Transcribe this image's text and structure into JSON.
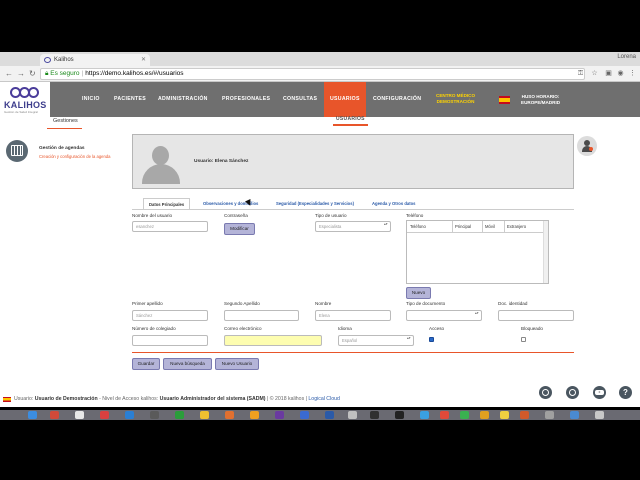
{
  "browser": {
    "tab_title": "Kalihos",
    "profile": "Lorena",
    "secure_label": "Es seguro",
    "url": "https://demo.kalihos.es/#/usuarios"
  },
  "logo": {
    "brand": "KALIHOS",
    "tagline": "Gestión de Salud Integral"
  },
  "menu": {
    "inicio": "INICIO",
    "pacientes": "PACIENTES",
    "administracion": "ADMINISTRACIÓN",
    "profesionales": "PROFESIONALES",
    "consultas": "CONSULTAS",
    "usuarios": "USUARIOS",
    "configuracion": "CONFIGURACIÓN"
  },
  "center": {
    "line1": "CENTRO MÉDICO",
    "line2": "DEMOSTRACIÓN"
  },
  "timezone": {
    "line1": "HUSO HORARIO:",
    "line2": "EUROPE/MADRID"
  },
  "subnav": {
    "gestiones": "Gestiones",
    "usuarios": "USUARIOS"
  },
  "agenda": {
    "title": "Gestión de agendas",
    "subtitle": "Creación y configuración de la agenda"
  },
  "profile": {
    "name": "Usuario: Elena Sánchez"
  },
  "tabs": {
    "datos": "Datos Principales",
    "observaciones": "Observaciones y domicilios",
    "seguridad": "Seguridad (Especialidades y Servicios)",
    "agenda": "Agenda y Otros datos"
  },
  "form": {
    "nombre_usuario_label": "Nombre del usuario",
    "nombre_usuario_value": "esanchez",
    "contrasena_label": "Contraseña",
    "modificar": "Modificar",
    "tipo_usuario_label": "Tipo de usuario",
    "tipo_usuario_value": "Especialista",
    "telefono_label": "Teléfono",
    "phone_cols": [
      "Teléfono",
      "Principal",
      "Móvil",
      "Extranjero"
    ],
    "nuevo": "Nuevo",
    "primer_apellido_label": "Primer apellido",
    "primer_apellido_value": "Sánchez",
    "segundo_apellido_label": "Segundo Apellido",
    "nombre_label": "Nombre",
    "nombre_value": "Elena",
    "tipo_documento_label": "Tipo de documento",
    "doc_identidad_label": "Doc. identidad",
    "colegiado_label": "Número de colegiado",
    "email_label": "Correo electrónico",
    "idioma_label": "Idioma",
    "idioma_value": "Español",
    "acceso_label": "Acceso",
    "bloqueado_label": "Bloqueado"
  },
  "actions": {
    "guardar": "Guardar",
    "nueva_busqueda": "Nueva búsqueda",
    "nuevo_usuario": "Nuevo Usuario"
  },
  "footer": {
    "prefix": "Usuario:",
    "user": "Usuario de Demostración",
    "mid": "- Nivel de Acceso kalihos:",
    "level": "Usuario Administrador del sistema (SADM)",
    "copy": "| © 2018 kalihos |",
    "link": "Logical Cloud"
  },
  "colors": {
    "accent": "#e8552a",
    "nav": "#6f6f6f",
    "brand": "#3d3d8c",
    "button": "#b4b4d8"
  }
}
